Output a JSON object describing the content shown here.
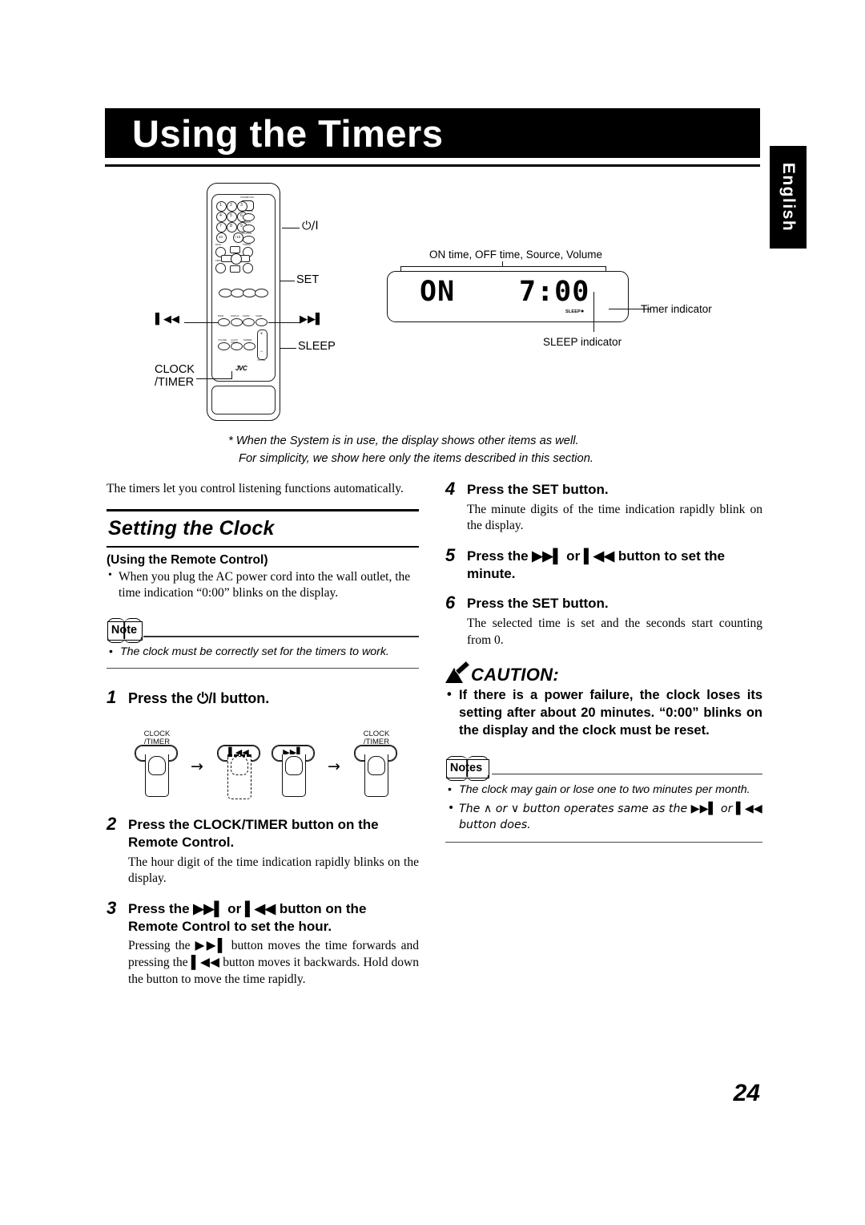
{
  "page": {
    "title": "Using the Timers",
    "language_tab": "English",
    "page_number": "24"
  },
  "remote_figure": {
    "callouts": {
      "power": "⏻/I",
      "set": "SET",
      "sleep": "SLEEP",
      "clock_timer_line1": "CLOCK",
      "clock_timer_line2": "/TIMER",
      "prev": "▌◀◀",
      "next": "▶▶▌"
    },
    "brand": "JVC",
    "keypad": [
      "1",
      "2",
      "3",
      "4",
      "5",
      "6",
      "7",
      "8",
      "9",
      "10",
      "+10"
    ],
    "side_labels": [
      "STANDBY/ON",
      "PLAY MODE",
      "REPEAT",
      "FM MODE",
      "TREBLE",
      "CANCEL",
      "BASS",
      "PRESET"
    ],
    "transport_labels": [
      "REC",
      "+10",
      "■",
      "▶▶"
    ],
    "row_labels": [
      "BAND",
      "DISPLAY",
      "FM/AM/CD",
      "SLEEP",
      "VOLUME",
      "CLOCK /TIMER",
      "DIMMER"
    ],
    "volume_plus": "+",
    "volume_minus": "−",
    "volume_label": "VOLUME"
  },
  "lcd_figure": {
    "top_caption": "ON time, OFF time, Source, Volume",
    "segment_left": "ON",
    "segment_right": "7:00",
    "sleep_text": "SLEEP",
    "timer_indicator_label": "Timer indicator",
    "sleep_indicator_label": "SLEEP indicator"
  },
  "footnote": {
    "line1": "* When the System is in use, the display shows other items as well.",
    "line2": "For simplicity, we show here only the items described in this section."
  },
  "left_column": {
    "intro": "The timers let you control listening functions automatically.",
    "section_heading": "Setting the Clock",
    "sub_heading": "(Using the Remote Control)",
    "sub_bullet": "When you plug the AC power cord into the wall outlet, the time indication “0:00” blinks on the display.",
    "note_badge": "Note",
    "note_item": "The clock must be correctly set for the timers to work.",
    "steps": [
      {
        "num": "1",
        "title": "Press the ⏻/I button.",
        "body": ""
      },
      {
        "num": "2",
        "title": "Press the CLOCK/TIMER button on the Remote Control.",
        "body": "The hour digit of the time indication rapidly blinks on the display."
      },
      {
        "num": "3",
        "title": "Press the ▶▶▌ or ▌◀◀ button on the Remote Control to set the hour.",
        "body": "Pressing the ▶▶▌ button moves the time forwards and pressing the ▌◀◀ button moves it backwards. Hold down the button to move the time rapidly."
      }
    ],
    "finger_diagram": {
      "step1_label_line1": "CLOCK",
      "step1_label_line2": "/TIMER",
      "step2_icon": "▌◀◀",
      "step3_icon": "▶▶▌",
      "step4_label_line1": "CLOCK",
      "step4_label_line2": "/TIMER",
      "arrow": "→"
    }
  },
  "right_column": {
    "steps": [
      {
        "num": "4",
        "title": "Press the SET button.",
        "body": "The minute digits of the time indication rapidly blink on the display."
      },
      {
        "num": "5",
        "title": "Press the ▶▶▌ or ▌◀◀ button to set the minute.",
        "body": ""
      },
      {
        "num": "6",
        "title": "Press the SET button.",
        "body": "The selected time is set and the seconds start counting from 0."
      }
    ],
    "caution_heading": "CAUTION:",
    "caution_item": "If there is a power failure, the clock loses its setting after about 20 minutes. “0:00” blinks on the display and the clock must be reset.",
    "notes_badge": "Notes",
    "notes_items": [
      "The clock may gain or lose one to two minutes per month.",
      "The ∧ or ∨ button operates same as the ▶▶▌ or ▌◀◀ button does."
    ]
  }
}
